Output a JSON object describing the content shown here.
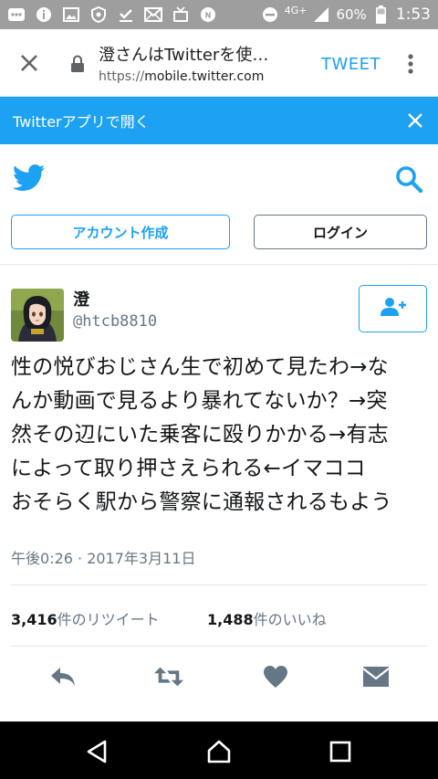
{
  "status_bar": {
    "network": "4G+",
    "battery": "60%",
    "time": "1:53"
  },
  "browser": {
    "title": "澄さんはTwitterを使…",
    "url_scheme": "https://",
    "url_host": "mobile.twitter.com",
    "tweet_button": "TWEET"
  },
  "banner": {
    "text": "Twitterアプリで開く"
  },
  "header": {
    "signup_label": "アカウント作成",
    "login_label": "ログイン"
  },
  "tweet": {
    "user_name": "澄",
    "user_handle": "@htcb8810",
    "text_lines": [
      "性の悦びおじさん生で初めて見たわ→な",
      "んか動画で見るより暴れてないか？→突",
      "然その辺にいた乗客に殴りかかる→有志",
      "によって取り押さえられる←イマココ",
      "おそらく駅から警察に通報されるもよう"
    ],
    "timestamp": "午後0:26 · 2017年3月11日",
    "retweet_count": "3,416",
    "retweet_label": "件のリツイート",
    "like_count": "1,488",
    "like_label": "件のいいね"
  },
  "colors": {
    "twitter_blue": "#1da1f2",
    "status_gray": "#9e9e9e",
    "action_gray": "#657786"
  }
}
